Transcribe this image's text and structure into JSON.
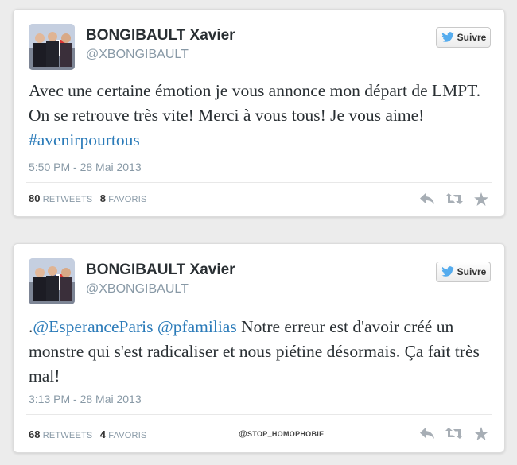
{
  "tweets": [
    {
      "author_name": "BONGIBAULT Xavier",
      "handle": "@XBONGIBAULT",
      "follow_label": "Suivre",
      "text_plain": "Avec une certaine émotion je vous annonce mon départ de LMPT. On se retrouve très vite! Merci à vous tous! Je vous aime! ",
      "hashtag": "#avenirpourtous",
      "timestamp": "5:50 PM - 28 Mai 2013",
      "retweets_count": "80",
      "retweets_label": "RETWEETS",
      "favorites_count": "8",
      "favorites_label": "FAVORIS"
    },
    {
      "author_name": "BONGIBAULT Xavier",
      "handle": "@XBONGIBAULT",
      "follow_label": "Suivre",
      "prefix": ".",
      "mention1": "@EsperanceParis",
      "mention2": "@pfamilias",
      "text_plain": " Notre erreur est d'avoir créé un monstre qui s'est radicaliser et nous piétine désormais. Ça fait très mal!",
      "timestamp": "3:13 PM - 28 Mai 2013",
      "retweets_count": "68",
      "retweets_label": "RETWEETS",
      "favorites_count": "4",
      "favorites_label": "FAVORIS"
    }
  ],
  "watermark": {
    "at": "@",
    "text": "STOP_HOMOPHOBIE"
  },
  "icons": {
    "follow_bird": "twitter-bird-icon",
    "reply": "reply-icon",
    "retweet": "retweet-icon",
    "favorite": "star-icon"
  },
  "colors": {
    "link": "#2b7bb9",
    "twitter_blue": "#55acee",
    "muted": "#8899a6"
  }
}
